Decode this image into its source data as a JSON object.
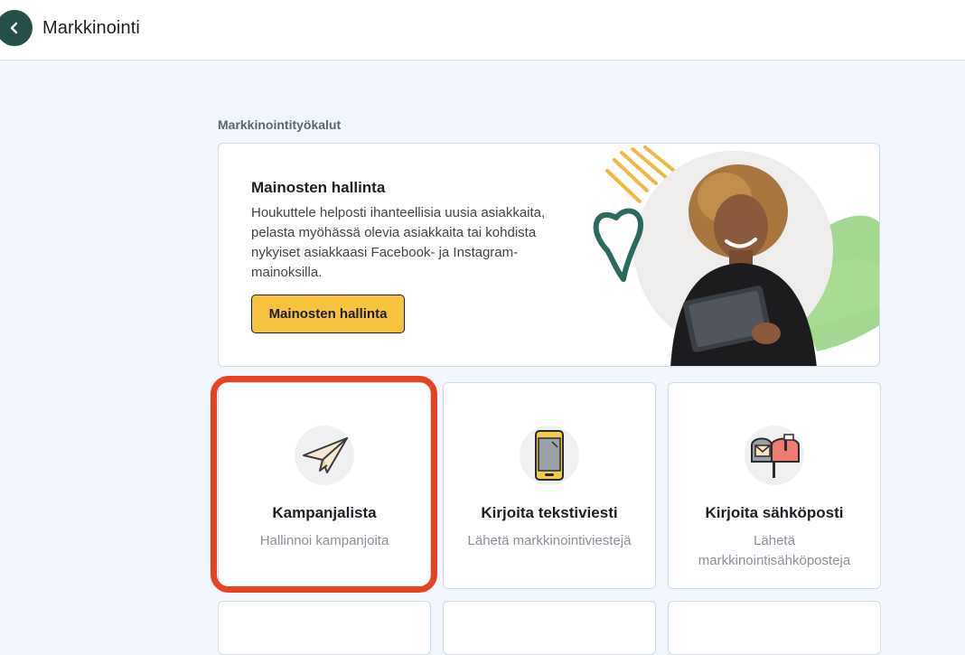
{
  "header": {
    "title": "Markkinointi",
    "back_icon": "chevron-left-icon"
  },
  "section": {
    "label": "Markkinointityökalut"
  },
  "ad_card": {
    "title": "Mainosten hallinta",
    "description": "Houkuttele helposti ihanteellisia uusia asiakkaita, pelasta myöhässä olevia asiakkaita tai kohdista nykyiset asiakkaasi Facebook- ja Instagram-mainoksilla.",
    "button_label": "Mainosten hallinta",
    "button_color": "#f5c33e"
  },
  "tools": [
    {
      "title": "Kampanjalista",
      "subtitle": "Hallinnoi kampanjoita",
      "icon": "paper-plane-icon",
      "highlighted": true
    },
    {
      "title": "Kirjoita tekstiviesti",
      "subtitle": "Lähetä markkinointiviestejä",
      "icon": "phone-icon",
      "highlighted": false
    },
    {
      "title": "Kirjoita sähköposti",
      "subtitle": "Lähetä markkinointisähköposteja",
      "icon": "mailbox-icon",
      "highlighted": false
    }
  ],
  "colors": {
    "accent_dark_green": "#23504a",
    "highlight_red": "#ea4221",
    "page_background": "#f1f7fc"
  }
}
